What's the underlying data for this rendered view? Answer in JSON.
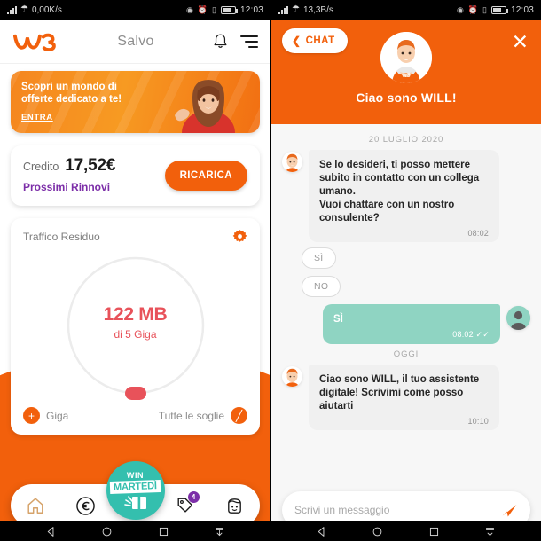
{
  "left": {
    "status": {
      "network_speed": "0,00K/s",
      "clock": "12:03",
      "icons": [
        "signal-icon",
        "wifi-icon",
        "eye-icon",
        "alarm-icon",
        "vibrate-icon",
        "battery-icon"
      ]
    },
    "header": {
      "logo": "windtre-w3-logo",
      "greeting": "Salvo",
      "bell": "bell-icon",
      "menu": "hamburger-menu-icon"
    },
    "promo": {
      "line1": "Scopri un mondo di",
      "line2": "offerte dedicato a te!",
      "cta": "ENTRA"
    },
    "credit": {
      "label": "Credito",
      "amount": "17,52€",
      "link": "Prossimi Rinnovi",
      "topup_button": "RICARICA"
    },
    "traffic": {
      "title": "Traffico Residuo",
      "settings_icon": "gear-icon",
      "remaining": "122 MB",
      "total": "di 5 Giga",
      "add_label": "Giga",
      "add_icon": "plus-icon",
      "thresholds_label": "Tutte le soglie",
      "thresholds_icon": "block-icon"
    },
    "bottom_nav": {
      "items": [
        {
          "name": "home",
          "icon": "home-icon"
        },
        {
          "name": "credit",
          "icon": "euro-icon"
        },
        {
          "name": "offers",
          "icon": "tag-icon",
          "badge": "4"
        },
        {
          "name": "profile",
          "icon": "face-icon"
        }
      ],
      "win_bubble": {
        "line1": "WIN",
        "line2": "MARTEDÌ"
      }
    },
    "colors": {
      "brand_orange": "#f2600c",
      "accent_purple": "#7c2ea8",
      "data_red": "#e8525a",
      "teal": "#34bfae"
    }
  },
  "right": {
    "status": {
      "network_speed": "13,3B/s",
      "clock": "12:03"
    },
    "header": {
      "back_button": "CHAT",
      "back_icon": "chevron-left-icon",
      "close_icon": "close-icon",
      "avatar": "will-bot-avatar",
      "title": "Ciao sono WILL!"
    },
    "conversation": [
      {
        "kind": "day",
        "label": "20 LUGLIO 2020"
      },
      {
        "kind": "in",
        "text": "Se lo desideri, ti posso mettere subito in contatto con un collega umano.\nVuoi chattare con un nostro consulente?",
        "time": "08:02",
        "avatar": "will-bot-avatar"
      },
      {
        "kind": "chip",
        "label": "SÌ"
      },
      {
        "kind": "chip",
        "label": "NO"
      },
      {
        "kind": "out",
        "text": "SÌ",
        "time": "08:02",
        "status": "read-check-icon",
        "avatar": "user-avatar"
      },
      {
        "kind": "day",
        "label": "OGGI"
      },
      {
        "kind": "in",
        "text": "Ciao sono WILL, il tuo assistente digitale! Scrivimi come posso aiutarti",
        "time": "10:10",
        "avatar": "will-bot-avatar"
      }
    ],
    "composer": {
      "placeholder": "Scrivi un messaggio",
      "value": "",
      "send_icon": "send-icon"
    }
  },
  "android_nav": {
    "buttons": [
      "back-icon",
      "home-icon",
      "recents-icon",
      "hide-navbar-icon"
    ]
  }
}
